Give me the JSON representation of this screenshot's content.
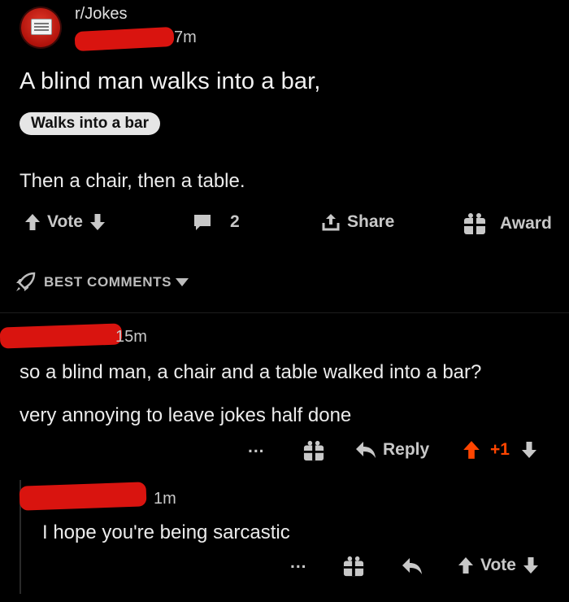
{
  "post": {
    "subreddit": "r/Jokes",
    "time": "7m",
    "title": "A blind man walks into a bar,",
    "flair": "Walks into a bar",
    "body": "Then a chair, then a table.",
    "vote_label": "Vote",
    "comments_count": "2",
    "share_label": "Share",
    "award_label": "Award"
  },
  "sort": {
    "label": "BEST COMMENTS"
  },
  "comments": [
    {
      "time": "15m",
      "lines": [
        "so a blind man, a chair and a table walked into a bar?",
        "very annoying to leave jokes half done"
      ],
      "more": "...",
      "reply_label": "Reply",
      "score": "+1"
    },
    {
      "time": "1m",
      "lines": [
        "I hope you're being sarcastic"
      ],
      "more": "...",
      "vote_label": "Vote"
    }
  ],
  "colors": {
    "upvote": "#ff4500",
    "redaction": "#d9140f",
    "background": "#000000"
  }
}
